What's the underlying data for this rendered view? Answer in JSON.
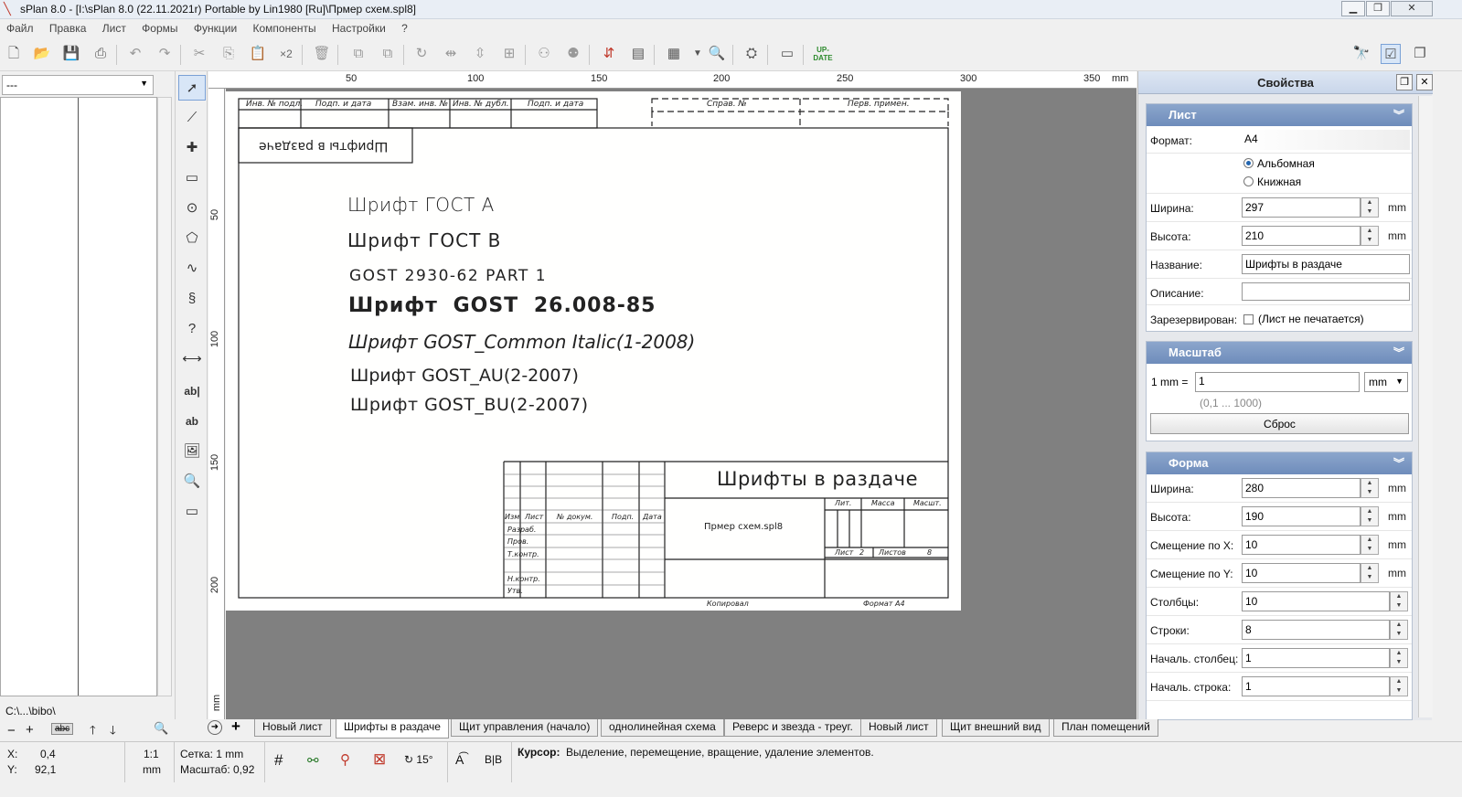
{
  "window": {
    "title": "sPlan 8.0 - [I:\\sPlan 8.0 (22.11.2021r) Portable by Lin1980 [Ru]\\Прмер схем.spl8]",
    "controls": {
      "minimize": "▁",
      "restore": "❐",
      "close": "✕"
    }
  },
  "menu": [
    "Файл",
    "Правка",
    "Лист",
    "Формы",
    "Функции",
    "Компоненты",
    "Настройки",
    "?"
  ],
  "toolbar": {
    "x2_label": "×2",
    "update_label": "UP-DATE"
  },
  "left_panel": {
    "select_value": "---",
    "path": "C:\\...\\bibo\\",
    "search_value": "abc"
  },
  "tools": [
    "select-arrow",
    "polyline",
    "junction",
    "rectangle",
    "circle",
    "polygon",
    "bezier",
    "freehand",
    "help",
    "dimension",
    "text",
    "text-frame",
    "image",
    "zoom",
    "ruler"
  ],
  "ruler": {
    "top_labels": [
      "50",
      "100",
      "150",
      "200",
      "250",
      "300",
      "350"
    ],
    "unit": "mm",
    "left_labels": [
      "50",
      "100",
      "150",
      "200"
    ],
    "left_unit": "mm"
  },
  "sheet": {
    "stamp_headers_top": [
      "Инв. № подл.",
      "Подп. и дата",
      "Взам. инв. №",
      "Инв. № дубл.",
      "Подп. и дата"
    ],
    "dashed_headers": [
      "Справ. №",
      "Перв. примен."
    ],
    "rotated_title": "Шрифты в раздаче",
    "font_samples": [
      "Шрифт ГОСТ А",
      "Шрифт ГОСТ В",
      "GOST 2930-62 PART 1",
      "Шрифт GOST 26.008-85",
      "Шрифт GOST_Common Italic(1-2008)",
      "Шрифт GOST_AU(2-2007)",
      "Шрифт GOST_BU(2-2007)"
    ],
    "titleblock": {
      "title": "Шрифты в раздаче",
      "filename": "Прмер схем.spl8",
      "row_labels": [
        "Изм",
        "Лист",
        "№ докум.",
        "Подп.",
        "Дата"
      ],
      "roles": [
        "Разраб.",
        "Пров.",
        "Т.контр.",
        "Н.контр.",
        "Утв."
      ],
      "lit": "Лит.",
      "mass": "Масса",
      "scale": "Масшт.",
      "sheet_label": "Лист",
      "sheet_num": "2",
      "sheets_label": "Листов",
      "sheets_num": "8",
      "copied": "Копировал",
      "format": "Формат А4"
    }
  },
  "properties": {
    "title": "Свойства",
    "sheet_section": {
      "title": "Лист",
      "format_label": "Формат:",
      "format_value": "A4",
      "orientation_landscape": "Альбомная",
      "orientation_portrait": "Книжная",
      "width_label": "Ширина:",
      "width_value": "297",
      "height_label": "Высота:",
      "height_value": "210",
      "unit": "mm",
      "name_label": "Название:",
      "name_value": "Шрифты в раздаче",
      "desc_label": "Описание:",
      "desc_value": "",
      "reserved_label": "Зарезервирован:",
      "reserved_text": "(Лист не печатается)"
    },
    "scale_section": {
      "title": "Масштаб",
      "mm_label": "1 mm =",
      "value": "1",
      "unit": "mm",
      "range": "(0,1 ... 1000)",
      "reset": "Сброс"
    },
    "form_section": {
      "title": "Форма",
      "rows": [
        {
          "label": "Ширина:",
          "value": "280",
          "unit": "mm"
        },
        {
          "label": "Высота:",
          "value": "190",
          "unit": "mm"
        },
        {
          "label": "Смещение по X:",
          "value": "10",
          "unit": "mm"
        },
        {
          "label": "Смещение по Y:",
          "value": "10",
          "unit": "mm"
        },
        {
          "label": "Столбцы:",
          "value": "10",
          "unit": ""
        },
        {
          "label": "Строки:",
          "value": "8",
          "unit": ""
        },
        {
          "label": "Началь. столбец:",
          "value": "1",
          "unit": ""
        },
        {
          "label": "Началь. строка:",
          "value": "1",
          "unit": ""
        }
      ]
    }
  },
  "tabs": [
    "Новый лист",
    "Шрифты в раздаче",
    "Щит управления (начало)",
    "однолинейная схема",
    "Реверс и звезда - треуг.",
    "Новый лист",
    "Щит внешний вид",
    "План помещений"
  ],
  "status": {
    "x_label": "X:",
    "x_value": "0,4",
    "y_label": "Y:",
    "y_value": "92,1",
    "ratio": "1:1",
    "ratio_unit": "mm",
    "grid": "Сетка: 1 mm",
    "zoom": "Масштаб: 0,92",
    "angle": "15°",
    "cursor_label": "Курсор:",
    "cursor_text": "Выделение, перемещение, вращение, удаление элементов."
  }
}
